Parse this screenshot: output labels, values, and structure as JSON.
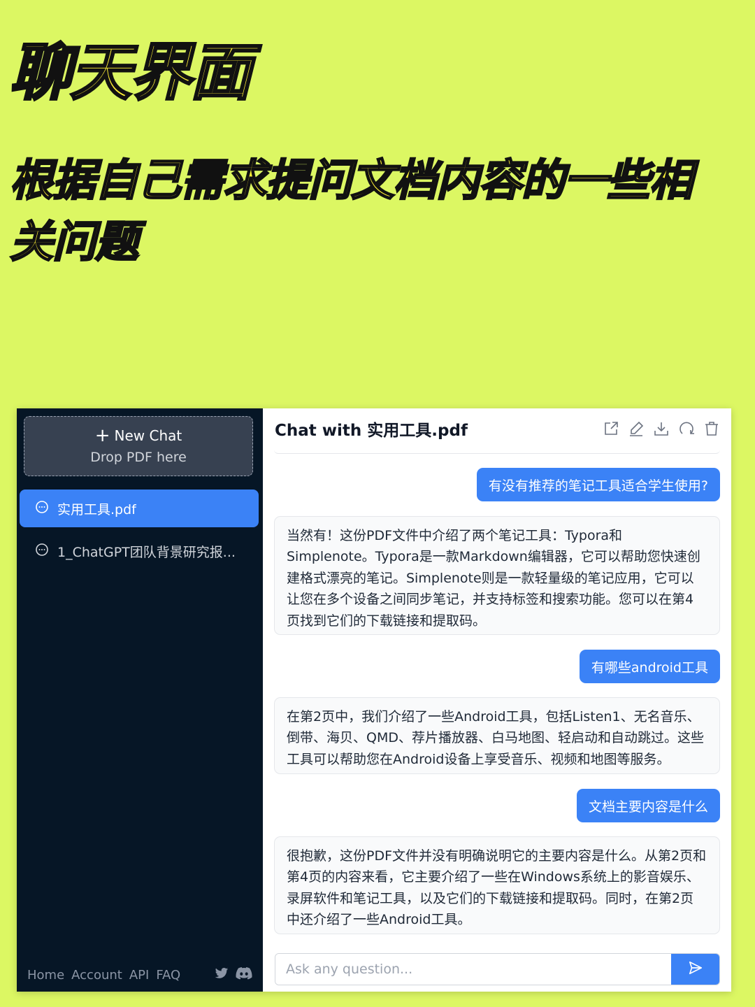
{
  "hero": {
    "title": "聊天界面",
    "subtitle": "根据自己需求提问文档内容的一些相关问题"
  },
  "sidebar": {
    "new_chat_label": "New Chat",
    "drop_label": "Drop PDF here",
    "chats": [
      {
        "label": "实用工具.pdf",
        "active": true,
        "icon": "chat-bubble-icon"
      },
      {
        "label": "1_ChatGPT团队背景研究报...",
        "active": false,
        "icon": "chat-bubble-icon"
      }
    ],
    "footer_links": [
      "Home",
      "Account",
      "API",
      "FAQ"
    ],
    "social_icons": [
      "twitter-icon",
      "discord-icon"
    ]
  },
  "chat": {
    "title": "Chat with 实用工具.pdf",
    "toolbar_icons": [
      "share-icon",
      "edit-icon",
      "download-icon",
      "refresh-icon",
      "trash-icon"
    ],
    "messages": [
      {
        "role": "user",
        "text": "有没有推荐的笔记工具适合学生使用?"
      },
      {
        "role": "assistant",
        "text": "当然有！这份PDF文件中介绍了两个笔记工具：Typora和Simplenote。Typora是一款Markdown编辑器，它可以帮助您快速创建格式漂亮的笔记。Simplenote则是一款轻量级的笔记应用，它可以让您在多个设备之间同步笔记，并支持标签和搜索功能。您可以在第4页找到它们的下载链接和提取码。"
      },
      {
        "role": "user",
        "text": "有哪些android工具"
      },
      {
        "role": "assistant",
        "text": "在第2页中，我们介绍了一些Android工具，包括Listen1、无名音乐、倒带、海贝、QMD、荐片播放器、白马地图、轻启动和自动跳过。这些工具可以帮助您在Android设备上享受音乐、视频和地图等服务。"
      },
      {
        "role": "user",
        "text": "文档主要内容是什么"
      },
      {
        "role": "assistant",
        "text": "很抱歉，这份PDF文件并没有明确说明它的主要内容是什么。从第2页和第4页的内容来看，它主要介绍了一些在Windows系统上的影音娱乐、录屏软件和笔记工具，以及它们的下载链接和提取码。同时，在第2页中还介绍了一些Android工具。"
      }
    ],
    "input_placeholder": "Ask any question...",
    "send_icon": "send-icon"
  },
  "colors": {
    "background": "#dcf763",
    "sidebar": "#061626",
    "accent": "#3b82f6",
    "hero_text": "#fff036"
  }
}
